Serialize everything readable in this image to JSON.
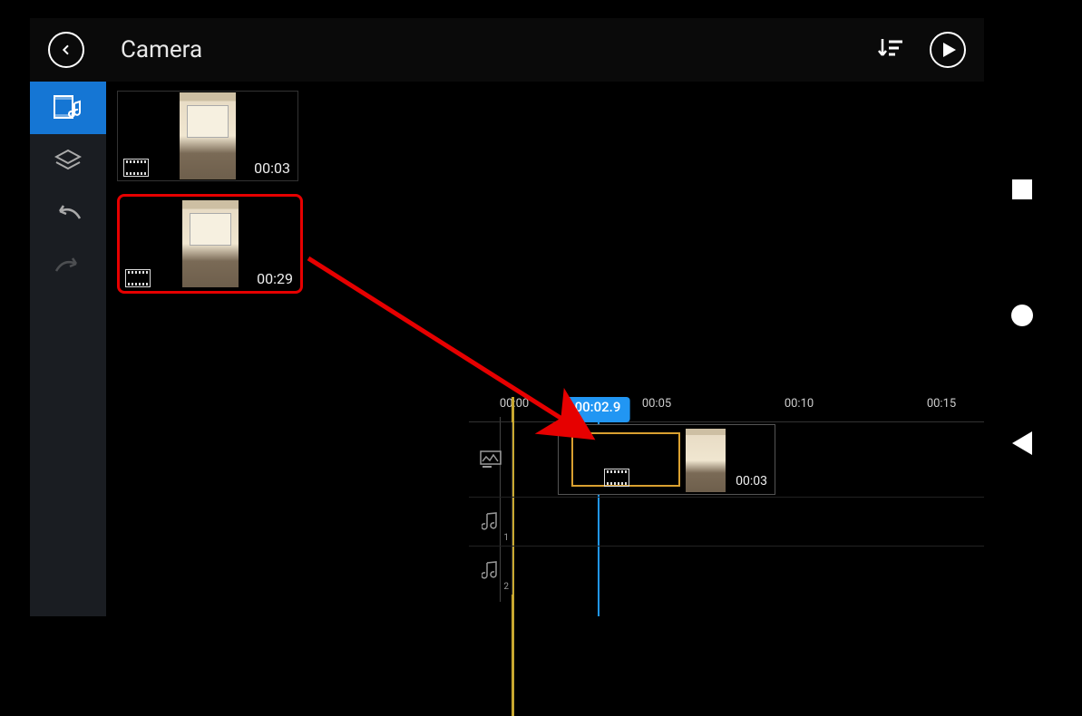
{
  "header": {
    "title": "Camera"
  },
  "sidebar": {
    "items": [
      {
        "name": "media-music-icon",
        "active": true
      },
      {
        "name": "layers-icon",
        "active": false
      },
      {
        "name": "undo-icon",
        "active": false
      },
      {
        "name": "redo-icon",
        "active": false
      }
    ]
  },
  "clips": [
    {
      "duration": "00:03",
      "selected": false
    },
    {
      "duration": "00:29",
      "selected": true
    }
  ],
  "timeline": {
    "ticks": [
      "00:00",
      "00:05",
      "00:10",
      "00:15"
    ],
    "playhead_label": "00:02.9",
    "tracks": [
      {
        "name": "video-track",
        "icon": "video",
        "sub": ""
      },
      {
        "name": "audio-track-1",
        "icon": "audio",
        "sub": "1"
      },
      {
        "name": "audio-track-2",
        "icon": "audio",
        "sub": "2"
      }
    ],
    "timeline_clip": {
      "duration": "00:03"
    }
  },
  "icons": {
    "back": "back",
    "sort": "sort",
    "play": "play"
  }
}
